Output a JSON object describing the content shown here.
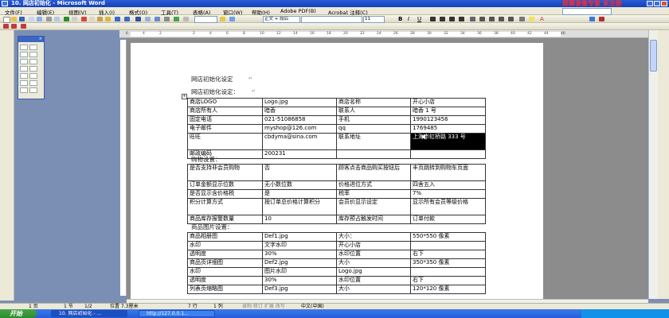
{
  "window": {
    "title": "10. 网店初始化 - Microsoft Word",
    "recorder_label": "屏幕录像专家 未注册"
  },
  "menu": {
    "items": [
      "文件(F)",
      "编辑(E)",
      "视图(V)",
      "插入(I)",
      "格式(O)",
      "工具(T)",
      "表格(A)",
      "窗口(W)",
      "帮助(H)",
      "Adobe PDF(B)",
      "Acrobat 注释(C)"
    ],
    "help_box": ""
  },
  "toolbar": {
    "style_value": "正文 + 段后",
    "font_value": "",
    "size_value": "11",
    "bold": "B",
    "italic": "I",
    "underline": "U",
    "font_color": "A"
  },
  "ruler": {
    "ticks": [
      "6",
      "4",
      "2",
      "",
      "2",
      "4",
      "6",
      "8",
      "10",
      "12",
      "14",
      "16",
      "18",
      "20",
      "22",
      "24",
      "26",
      "28",
      "30",
      "32",
      "34",
      "36",
      "38",
      "40",
      "42",
      "44",
      "46"
    ]
  },
  "document": {
    "heading1": "网店初始化设定",
    "heading2": "网店初始化设定：",
    "section2": "购物设置：",
    "section3": "商品图片设置：",
    "table1": [
      [
        "商店LOGO",
        "Logo.jpg",
        "商店名称",
        "开心小店"
      ],
      [
        "商店所有人",
        "暗香",
        "联系人",
        "暗香 1 号"
      ],
      [
        "固定电话",
        "021-51086858",
        "手机",
        "1990123456"
      ],
      [
        "电子邮件",
        "myshop@126.com",
        "qq",
        "1769485"
      ],
      [
        "旺旺",
        "cbdyma@sina.com",
        "联系地址",
        "上海市虹桥路 333 号"
      ],
      [
        "邮政编码",
        "200231",
        "",
        ""
      ]
    ],
    "table2": [
      [
        "是否支持非会员购物",
        "否",
        "顾客点击商品购买按钮后",
        "丰页跳转到购物车页面"
      ],
      [
        "订单金额显示位数",
        "无小数位数",
        "价格进位方式",
        "四舍五入"
      ],
      [
        "是否显示含价格税",
        "是",
        "税率",
        "7%"
      ],
      [
        "积分计算方式",
        "按订单总价格计算积分",
        "会员价显示设定",
        "显示所有会员等级价格"
      ],
      [
        "商品库存报警数量",
        "10",
        "库存预占触发时间",
        "订单付款"
      ]
    ],
    "table3": [
      [
        "商品相册图",
        "Def1.jpg",
        "大小：",
        "550*550 像素"
      ],
      [
        "水印",
        "文字水印",
        "开心小店",
        ""
      ],
      [
        "透明度",
        "30%",
        "水印位置",
        "右下"
      ],
      [
        "商品页详细图",
        "Def2.jpg",
        "大小",
        "350*350 像素"
      ],
      [
        "水印",
        "图片水印",
        "Logo.jpg",
        ""
      ],
      [
        "透明度",
        "30%",
        "水印位置",
        "右下"
      ],
      [
        "列表页缩略图",
        "Def3.jpg",
        "大小",
        "120*120 像素"
      ]
    ]
  },
  "statusbar": {
    "page": "1 页",
    "section": "1 节",
    "pages": "1/2",
    "position": "位置 7.3厘米",
    "line": "7 行",
    "col": "1 列",
    "modes": "录制  修订  扩展  改写",
    "lang": "中文(中国)"
  },
  "taskbar": {
    "start": "开始",
    "tasks": [
      "10. 网店初始化 - ...",
      "http://127.0.0.1..."
    ],
    "tray_time": ""
  }
}
